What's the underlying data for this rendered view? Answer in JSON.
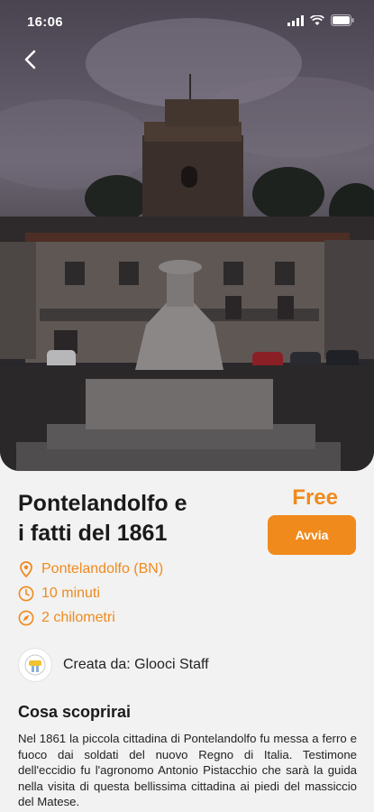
{
  "status_bar": {
    "time": "16:06"
  },
  "tour": {
    "title_line1": "Pontelandolfo e",
    "title_line2": "i fatti del 1861",
    "price": "Free",
    "start_label": "Avvia",
    "location": "Pontelandolfo (BN)",
    "duration": "10 minuti",
    "distance": "2 chilometri",
    "author": "Creata da: Glooci Staff",
    "section_title": "Cosa scoprirai",
    "description": "Nel 1861 la piccola cittadina di Pontelandolfo fu messa a ferro e fuoco dai soldati del nuovo Regno di Italia. Testimone dell'eccidio fu l'agronomo Antonio Pistacchio che sarà la guida nella visita di questa bellissima cittadina ai piedi del massiccio del Matese."
  },
  "colors": {
    "accent": "#f08a1c",
    "background": "#f2f2f2",
    "text": "#1a1a1a"
  },
  "icons": {
    "back": "chevron-left-icon",
    "location": "location-pin-icon",
    "duration": "clock-icon",
    "distance": "compass-icon"
  }
}
